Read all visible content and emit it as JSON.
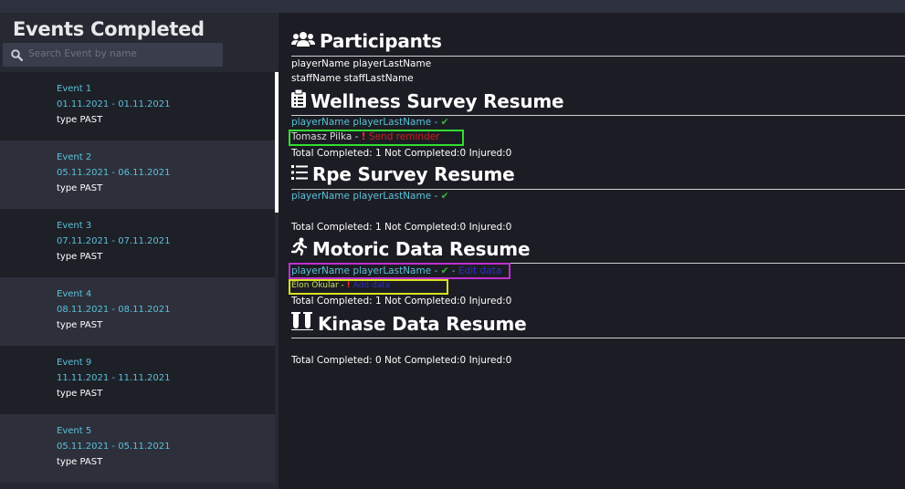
{
  "sidebar": {
    "title": "Events Completed",
    "search_placeholder": "Search Event by name",
    "events": [
      {
        "name": "Event 1",
        "dates": "01.11.2021 - 01.11.2021",
        "type": "type PAST"
      },
      {
        "name": "Event 2",
        "dates": "05.11.2021 - 06.11.2021",
        "type": "type PAST"
      },
      {
        "name": "Event 3",
        "dates": "07.11.2021 - 07.11.2021",
        "type": "type PAST"
      },
      {
        "name": "Event 4",
        "dates": "08.11.2021 - 08.11.2021",
        "type": "type PAST"
      },
      {
        "name": "Event 9",
        "dates": "11.11.2021 - 11.11.2021",
        "type": "type PAST"
      },
      {
        "name": "Event 5",
        "dates": "05.11.2021 - 05.11.2021",
        "type": "type PAST"
      }
    ]
  },
  "participants": {
    "title": "Participants",
    "player": "playerName playerLastName",
    "staff": "staffName staffLastName"
  },
  "wellness": {
    "title": "Wellness Survey Resume",
    "completed_player": "playerName playerLastName - ",
    "pending_player": "Tomasz Pilka - ",
    "reminder": "Send reminder",
    "totals": "Total Completed: 1 Not Completed:0 Injured:0"
  },
  "rpe": {
    "title": "Rpe Survey Resume",
    "completed_player": "playerName playerLastName - ",
    "totals": "Total Completed: 1 Not Completed:0 Injured:0"
  },
  "motoric": {
    "title": "Motoric Data Resume",
    "completed_player": "playerName playerLastName - ",
    "edit_link": "Edit data",
    "pending_player": "Elon Okular - ",
    "add_link": "Add data",
    "totals": "Total Completed: 1 Not Completed:0 Injured:0"
  },
  "kinase": {
    "title": "Kinase Data Resume",
    "totals": "Total Completed: 0 Not Completed:0 Injured:0"
  },
  "symbols": {
    "check": "✔",
    "exclaim": "!"
  },
  "colors": {
    "accent_cyan": "#5bc0d8",
    "check_green": "#3fb53f",
    "alert_red": "#ff2a2a",
    "link_blue": "#2e2ec8",
    "highlight_green": "#33dd33",
    "highlight_purple": "#c030d0",
    "highlight_yellow": "#d8e020"
  }
}
